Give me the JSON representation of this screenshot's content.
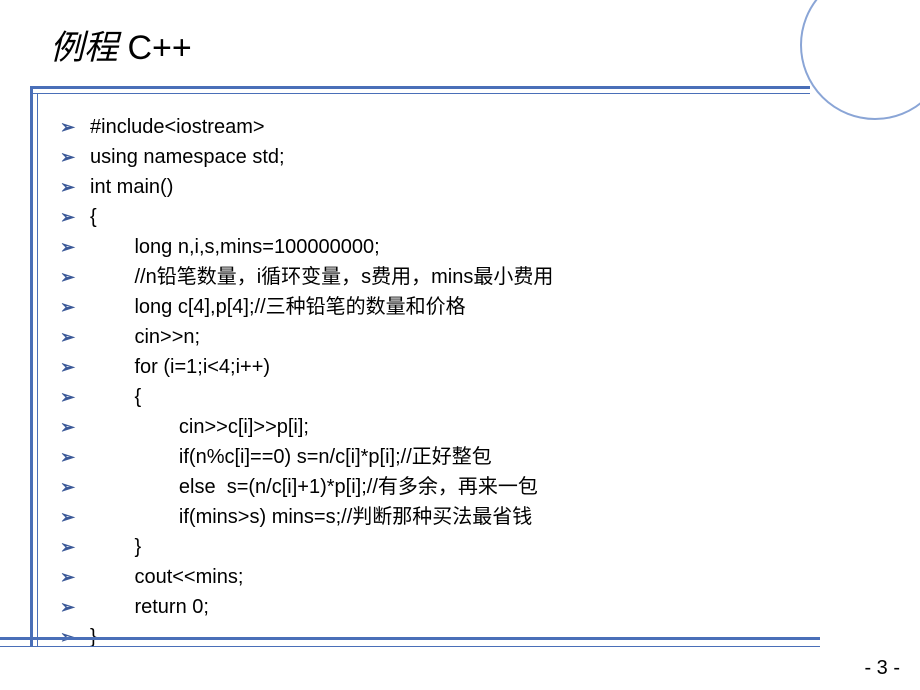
{
  "title": {
    "cn": "例程",
    "en": " C++"
  },
  "code_lines": [
    {
      "indent": 0,
      "text": "#include<iostream>"
    },
    {
      "indent": 0,
      "text": "using namespace std;"
    },
    {
      "indent": 0,
      "text": "int main()"
    },
    {
      "indent": 0,
      "text": "{"
    },
    {
      "indent": 1,
      "text": "long n,i,s,mins=100000000;"
    },
    {
      "indent": 1,
      "text": "//n铅笔数量，i循环变量，s费用，mins最小费用"
    },
    {
      "indent": 1,
      "text": "long c[4],p[4];//三种铅笔的数量和价格"
    },
    {
      "indent": 1,
      "text": "cin>>n;"
    },
    {
      "indent": 1,
      "text": "for (i=1;i<4;i++)"
    },
    {
      "indent": 1,
      "text": "{"
    },
    {
      "indent": 2,
      "text": "cin>>c[i]>>p[i];"
    },
    {
      "indent": 2,
      "text": "if(n%c[i]==0) s=n/c[i]*p[i];//正好整包"
    },
    {
      "indent": 2,
      "text": "else  s=(n/c[i]+1)*p[i];//有多余，再来一包"
    },
    {
      "indent": 2,
      "text": "if(mins>s) mins=s;//判断那种买法最省钱"
    },
    {
      "indent": 1,
      "text": "}"
    },
    {
      "indent": 1,
      "text": "cout<<mins;"
    },
    {
      "indent": 1,
      "text": "return 0;"
    },
    {
      "indent": 0,
      "text": "}"
    }
  ],
  "page_number": "- 3 -",
  "bullet_char": "➢"
}
